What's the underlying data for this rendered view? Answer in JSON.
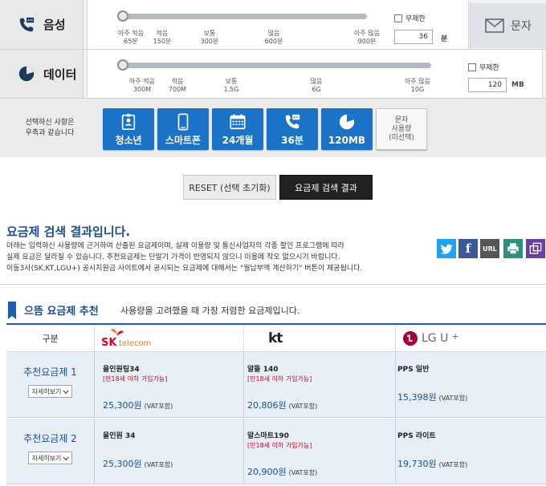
{
  "voice": {
    "label": "음성",
    "ticks": [
      {
        "line1": "아주 적음",
        "line2": "65분"
      },
      {
        "line1": "적음",
        "line2": "150분"
      },
      {
        "line1": "보통",
        "line2": "300분"
      },
      {
        "line1": "많음",
        "line2": "600분"
      },
      {
        "line1": "아주 많음",
        "line2": "900분"
      }
    ],
    "unlimited_label": "무제한",
    "value": "36",
    "unit": "분",
    "slider_position": 0.0
  },
  "data": {
    "label": "데이터",
    "ticks": [
      {
        "line1": "아주 적음",
        "line2": "300M"
      },
      {
        "line1": "적음",
        "line2": "700M"
      },
      {
        "line1": "보통",
        "line2": "1.5G"
      },
      {
        "line1": "많음",
        "line2": "6G"
      },
      {
        "line1": "아주 많음",
        "line2": "10G"
      }
    ],
    "unlimited_label": "무제한",
    "value": "120",
    "unit": "MB",
    "slider_position": 0.0
  },
  "message_button": {
    "label": "문자",
    "icon": "envelope-icon"
  },
  "selection": {
    "text_line1": "선택하신 사항은",
    "text_line2": "우측과 같습니다",
    "chips": [
      {
        "label": "청소년",
        "icon": "id-card-icon"
      },
      {
        "label": "스마트폰",
        "icon": "smartphone-icon"
      },
      {
        "label": "24개월",
        "icon": "calendar-icon"
      },
      {
        "label": "36분",
        "icon": "phone-talk-icon"
      },
      {
        "label": "120MB",
        "icon": "pie-chart-icon"
      }
    ],
    "message_chip": {
      "line1": "문자",
      "line2": "사용량",
      "line3": "(미선택)"
    }
  },
  "buttons": {
    "reset": "RESET (선택 초기화)",
    "search": "요금제 검색 결과"
  },
  "results": {
    "title": "요금제 검색 결과입니다.",
    "desc1": "아래는 입력하신 사용량에 근거하여 산출된 요금제이며, 실제 이용량 및 통신사업자의 각종 할인 프로그램에 따라",
    "desc2": "실제 요금은 달라질 수 있습니다. 추천요금제는 단말기 가격이 반영되지 않으니 이용에 착오 없으시기 바랍니다.",
    "desc3": "이동3사(SK,KT,LGU+) 공시지원금 사이트에서 공시되는 요금제에 대해서는 \"월납부액 계산하기\" 버튼이 제공됩니다.",
    "share": [
      {
        "name": "twitter",
        "label": "",
        "color": "#1da1f2"
      },
      {
        "name": "facebook",
        "label": "f",
        "color": "#3b5998"
      },
      {
        "name": "url",
        "label": "URL",
        "color": "#555555"
      },
      {
        "name": "print",
        "label": "",
        "color": "#2f8f7f"
      },
      {
        "name": "popup",
        "label": "",
        "color": "#6b3fa0"
      }
    ]
  },
  "recommend": {
    "title": "으뜸 요금제 추천",
    "subtitle": "사용량을 고려했을 때 가장 저렴한 요금제입니다.",
    "col_header": "구분",
    "carriers": {
      "skt": {
        "name": "SK",
        "sub": "telecom"
      },
      "kt": {
        "name": "kt"
      },
      "lgu": {
        "name": "LG U",
        "plus": "+"
      }
    },
    "rows": [
      {
        "name": "추천요금제 1",
        "detail": "자세히보기",
        "skt": {
          "plan": "올인원팅34",
          "note": "[만18세 이하 가입가능]",
          "price": "25,300원",
          "vat": "(VAT포함)"
        },
        "kt": {
          "plan": "알뜰 140",
          "note": "[만18세 이하 가입가능]",
          "price": "20,806원",
          "vat": "(VAT포함)"
        },
        "lgu": {
          "plan": "PPS 일반",
          "note": "",
          "price": "15,398원",
          "vat": "(VAT포함)"
        }
      },
      {
        "name": "추천요금제 2",
        "detail": "자세히보기",
        "skt": {
          "plan": "올인원 34",
          "note": "",
          "price": "25,300원",
          "vat": "(VAT포함)"
        },
        "kt": {
          "plan": "알스마트190",
          "note": "[만18세 이하 가입가능]",
          "price": "20,900원",
          "vat": "(VAT포함)"
        },
        "lgu": {
          "plan": "PPS 라이트",
          "note": "",
          "price": "19,730원",
          "vat": "(VAT포함)"
        }
      }
    ]
  }
}
